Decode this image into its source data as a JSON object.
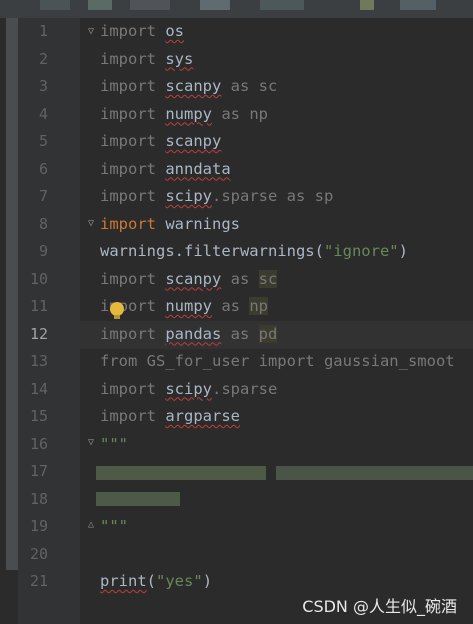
{
  "lines": [
    {
      "num": "1",
      "parts": [
        {
          "t": "import ",
          "c": "dim0"
        },
        {
          "t": "os",
          "c": "w"
        }
      ]
    },
    {
      "num": "2",
      "parts": [
        {
          "t": "import ",
          "c": "dim0"
        },
        {
          "t": "sys",
          "c": "w"
        }
      ]
    },
    {
      "num": "3",
      "parts": [
        {
          "t": "import ",
          "c": "dim0"
        },
        {
          "t": "scanpy",
          "c": "w"
        },
        {
          "t": " as sc",
          "c": "dim0"
        }
      ]
    },
    {
      "num": "4",
      "parts": [
        {
          "t": "import ",
          "c": "dim0"
        },
        {
          "t": "numpy",
          "c": "w"
        },
        {
          "t": " as np",
          "c": "dim0"
        }
      ]
    },
    {
      "num": "5",
      "parts": [
        {
          "t": "import ",
          "c": "dim0"
        },
        {
          "t": "scanpy",
          "c": "w"
        }
      ]
    },
    {
      "num": "6",
      "parts": [
        {
          "t": "import ",
          "c": "dim0"
        },
        {
          "t": "anndata",
          "c": "w"
        }
      ]
    },
    {
      "num": "7",
      "parts": [
        {
          "t": "import ",
          "c": "dim0"
        },
        {
          "t": "scipy",
          "c": "w"
        },
        {
          "t": ".sparse as sp",
          "c": "dim0"
        }
      ]
    },
    {
      "num": "8",
      "parts": [
        {
          "t": "import ",
          "c": "kw"
        },
        {
          "t": "warnings",
          "c": ""
        }
      ]
    },
    {
      "num": "9",
      "parts": [
        {
          "t": "warnings.filterwarnings(",
          "c": ""
        },
        {
          "t": "\"ignore\"",
          "c": "str"
        },
        {
          "t": ")",
          "c": ""
        }
      ]
    },
    {
      "num": "10",
      "parts": [
        {
          "t": "import ",
          "c": "dim0"
        },
        {
          "t": "scanpy",
          "c": "w"
        },
        {
          "t": " as ",
          "c": "dim0"
        },
        {
          "t": "sc",
          "c": "dimhl"
        }
      ]
    },
    {
      "num": "11",
      "parts": [
        {
          "t": "import ",
          "c": "dim0"
        },
        {
          "t": "numpy",
          "c": "w"
        },
        {
          "t": " as ",
          "c": "dim0"
        },
        {
          "t": "np",
          "c": "dimhl"
        }
      ]
    },
    {
      "num": "12",
      "parts": [
        {
          "t": "import ",
          "c": "dim0"
        },
        {
          "t": "pandas",
          "c": "w"
        },
        {
          "t": " as ",
          "c": "dim0"
        },
        {
          "t": "pd",
          "c": "dimhl"
        }
      ]
    },
    {
      "num": "13",
      "parts": [
        {
          "t": "from GS_for_user import gaussian_smoot",
          "c": "dim0"
        }
      ]
    },
    {
      "num": "14",
      "parts": [
        {
          "t": "import ",
          "c": "dim0"
        },
        {
          "t": "scipy",
          "c": "w"
        },
        {
          "t": ".sparse",
          "c": "dim0"
        }
      ]
    },
    {
      "num": "15",
      "parts": [
        {
          "t": "import ",
          "c": "dim0"
        },
        {
          "t": "argparse",
          "c": "w"
        }
      ]
    },
    {
      "num": "16",
      "parts": [
        {
          "t": "\"\"\"",
          "c": "str"
        }
      ]
    },
    {
      "num": "17",
      "parts": []
    },
    {
      "num": "18",
      "parts": []
    },
    {
      "num": "19",
      "parts": [
        {
          "t": "\"\"\"",
          "c": "str"
        }
      ]
    },
    {
      "num": "20",
      "parts": []
    },
    {
      "num": "21",
      "parts": [
        {
          "t": "print",
          "c": "w"
        },
        {
          "t": "(",
          "c": ""
        },
        {
          "t": "\"yes\"",
          "c": "str"
        },
        {
          "t": ")",
          "c": ""
        }
      ]
    }
  ],
  "current_line": "12",
  "watermark": "CSDN @人生似_碗酒",
  "colors": {
    "keyword": "#cc7832",
    "string": "#6a8759",
    "text": "#a9b7c6",
    "dim": "#787878",
    "background": "#2b2b2b",
    "gutter": "#313335"
  },
  "icons": [
    "intention-bulb-icon",
    "fold-marker-icon"
  ]
}
